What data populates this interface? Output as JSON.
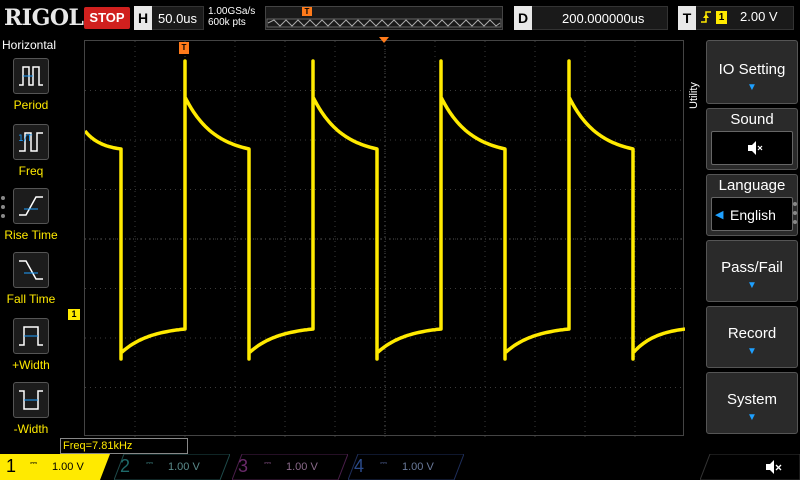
{
  "topbar": {
    "brand": "RIGOL",
    "run_status": "STOP",
    "timebase_letter": "H",
    "timebase": "50.0us",
    "sample_rate": "1.00GSa/s",
    "memory_depth": "600k pts",
    "trigger_marker": "T",
    "delay_letter": "D",
    "delay": "200.000000us",
    "trigger_letter": "T",
    "trigger_source": "1",
    "trigger_level": "2.00 V"
  },
  "left_panel": {
    "title": "Horizontal",
    "items": [
      {
        "label": "Period",
        "icon": "period-icon"
      },
      {
        "label": "Freq",
        "icon": "freq-icon"
      },
      {
        "label": "Rise Time",
        "icon": "rise-time-icon"
      },
      {
        "label": "Fall Time",
        "icon": "fall-time-icon"
      },
      {
        "label": "+Width",
        "icon": "pos-width-icon"
      },
      {
        "label": "-Width",
        "icon": "neg-width-icon"
      }
    ]
  },
  "right_panel": {
    "side_label": "Utility",
    "io_setting": "IO Setting",
    "sound_title": "Sound",
    "language_title": "Language",
    "language_value": "English",
    "pass_fail": "Pass/Fail",
    "record": "Record",
    "system": "System"
  },
  "grid": {
    "trigger_top_marker": "T",
    "ch1_ground_marker": "1"
  },
  "measurement": {
    "freq": "Freq=7.81kHz"
  },
  "channels": [
    {
      "num": "1",
      "coupling": "DC",
      "scale": "1.00 V",
      "color": "#ffea00",
      "active": true
    },
    {
      "num": "2",
      "coupling": "DC",
      "scale": "1.00 V",
      "color": "#00c8c8",
      "active": false
    },
    {
      "num": "3",
      "coupling": "DC",
      "scale": "1.00 V",
      "color": "#e040e0",
      "active": false
    },
    {
      "num": "4",
      "coupling": "DC",
      "scale": "1.00 V",
      "color": "#2080ff",
      "active": false
    }
  ],
  "colors": {
    "ch1": "#ffea00",
    "trigger": "#ff7a1a",
    "accent": "#1ea0ff",
    "stop": "#d0201e"
  }
}
